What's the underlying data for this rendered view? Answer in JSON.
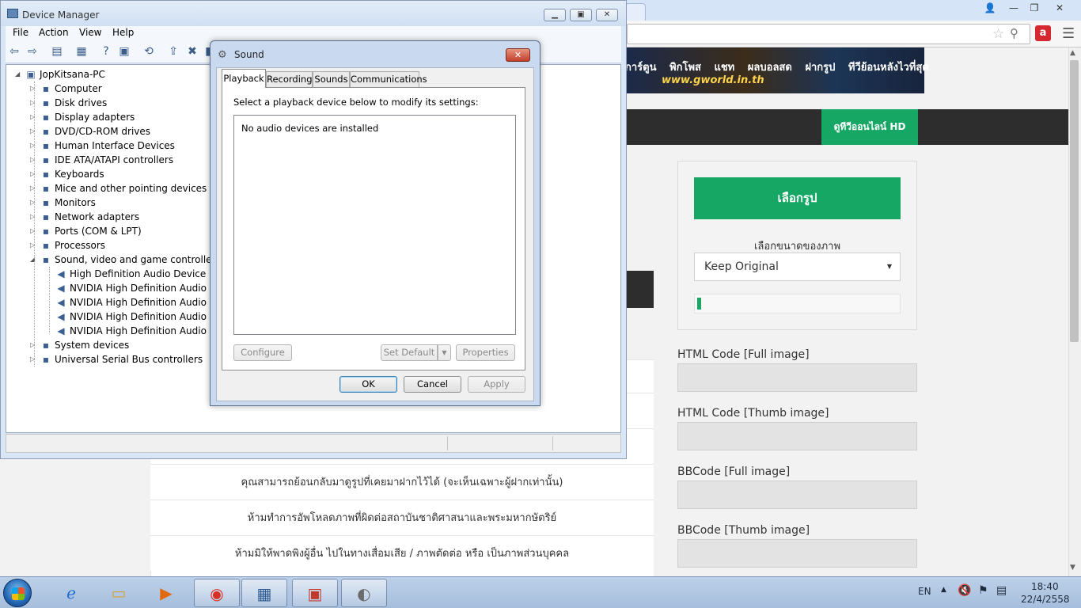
{
  "browser": {
    "controls": {
      "user": "👤",
      "minimize": "—",
      "restore": "❐",
      "close": "✕"
    },
    "banner_logo": "www.gworld.in.th",
    "nav_items": [
      "การ์ตูน",
      "พิกโพส",
      "แชท",
      "ผลบอลสด",
      "ฝากรูป",
      "ทีวีย้อนหลังไวที่สุด"
    ],
    "green_tab": "ดูทีวีออนไลน์ HD",
    "choose_button": "เลือกรูป",
    "size_label": "เลือกขนาดของภาพ",
    "size_select": "Keep Original",
    "progress_fraction": 0.02,
    "code_labels": [
      "HTML Code [Full image]",
      "HTML Code [Thumb image]",
      "BBCode [Full image]",
      "BBCode [Thumb image]"
    ],
    "rules": [
      "คุณสามารถย้อนกลับมาดูรูปที่เคยมาฝากไว้ได้ (จะเห็นเฉพาะผู้ฝากเท่านั้น)",
      "ห้ามทำการอัพโหลดภาพที่ผิดต่อสถาบันชาติศาสนาและพระมหากษัตริย์",
      "ห้ามมิให้พาดพิงผู้อื่น ไปในทางเสื่อมเสีย / ภาพตัดต่อ หรือ เป็นภาพส่วนบุคคล"
    ]
  },
  "device_manager": {
    "title": "Device Manager",
    "menu": [
      "File",
      "Action",
      "View",
      "Help"
    ],
    "root": "JopKitsana-PC",
    "categories": [
      "Computer",
      "Disk drives",
      "Display adapters",
      "DVD/CD-ROM drives",
      "Human Interface Devices",
      "IDE ATA/ATAPI controllers",
      "Keyboards",
      "Mice and other pointing devices",
      "Monitors",
      "Network adapters",
      "Ports (COM & LPT)",
      "Processors",
      "Sound, video and game controllers"
    ],
    "sound_children": [
      "High Definition Audio Device",
      "NVIDIA High Definition Audio",
      "NVIDIA High Definition Audio",
      "NVIDIA High Definition Audio",
      "NVIDIA High Definition Audio"
    ],
    "after_categories": [
      "System devices",
      "Universal Serial Bus controllers"
    ]
  },
  "sound_dialog": {
    "title": "Sound",
    "tabs": [
      "Playback",
      "Recording",
      "Sounds",
      "Communications"
    ],
    "instruction": "Select a playback device below to modify its settings:",
    "empty_message": "No audio devices are installed",
    "configure": "Configure",
    "set_default": "Set Default",
    "properties": "Properties",
    "ok": "OK",
    "cancel": "Cancel",
    "apply": "Apply"
  },
  "taskbar": {
    "language": "EN",
    "time": "18:40",
    "date": "22/4/2558"
  },
  "colors": {
    "accent_green": "#16a765",
    "dark_bar": "#2d2d2d"
  }
}
